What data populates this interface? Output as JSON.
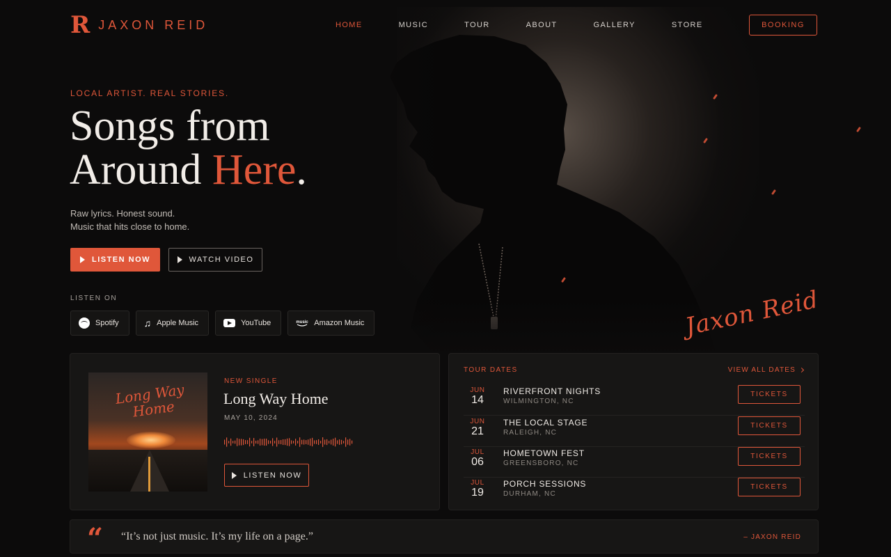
{
  "brand": {
    "mark": "R",
    "name": "JAXON REID"
  },
  "nav": {
    "items": [
      {
        "label": "HOME",
        "active": true
      },
      {
        "label": "MUSIC",
        "active": false
      },
      {
        "label": "TOUR",
        "active": false
      },
      {
        "label": "ABOUT",
        "active": false
      },
      {
        "label": "GALLERY",
        "active": false
      },
      {
        "label": "STORE",
        "active": false
      }
    ],
    "booking_label": "BOOKING"
  },
  "hero": {
    "eyebrow": "LOCAL ARTIST. REAL STORIES.",
    "headline_line1": "Songs from",
    "headline_line2_plain": "Around ",
    "headline_line2_accent": "Here",
    "headline_period": ".",
    "sub_line1": "Raw lyrics. Honest sound.",
    "sub_line2": "Music that hits close to home.",
    "listen_label": "LISTEN NOW",
    "watch_label": "WATCH VIDEO",
    "signature": "Jaxon Reid"
  },
  "listen_on": {
    "label": "LISTEN ON",
    "platforms": [
      {
        "name": "Spotify",
        "icon": "spotify-icon"
      },
      {
        "name": "Apple Music",
        "icon": "apple-music-icon"
      },
      {
        "name": "YouTube",
        "icon": "youtube-icon"
      },
      {
        "name": "Amazon Music",
        "icon": "amazon-music-icon"
      }
    ]
  },
  "single": {
    "eyebrow": "NEW SINGLE",
    "title": "Long Way Home",
    "date": "MAY 10, 2024",
    "album_title_line1": "Long Way",
    "album_title_line2": "Home",
    "listen_label": "LISTEN NOW"
  },
  "tour": {
    "label": "TOUR DATES",
    "view_all": "VIEW ALL DATES",
    "dates": [
      {
        "month": "JUN",
        "day": "14",
        "venue": "RIVERFRONT NIGHTS",
        "city": "WILMINGTON, NC",
        "cta": "TICKETS"
      },
      {
        "month": "JUN",
        "day": "21",
        "venue": "THE LOCAL STAGE",
        "city": "RALEIGH, NC",
        "cta": "TICKETS"
      },
      {
        "month": "JUL",
        "day": "06",
        "venue": "HOMETOWN FEST",
        "city": "GREENSBORO, NC",
        "cta": "TICKETS"
      },
      {
        "month": "JUL",
        "day": "19",
        "venue": "PORCH SESSIONS",
        "city": "DURHAM, NC",
        "cta": "TICKETS"
      }
    ]
  },
  "quote": {
    "mark": "“",
    "text": "“It’s not just music. It’s my life on a page.”",
    "author": "– JAXON REID"
  },
  "colors": {
    "accent": "#e0573a",
    "background": "#0c0b0b",
    "card": "#171615"
  }
}
